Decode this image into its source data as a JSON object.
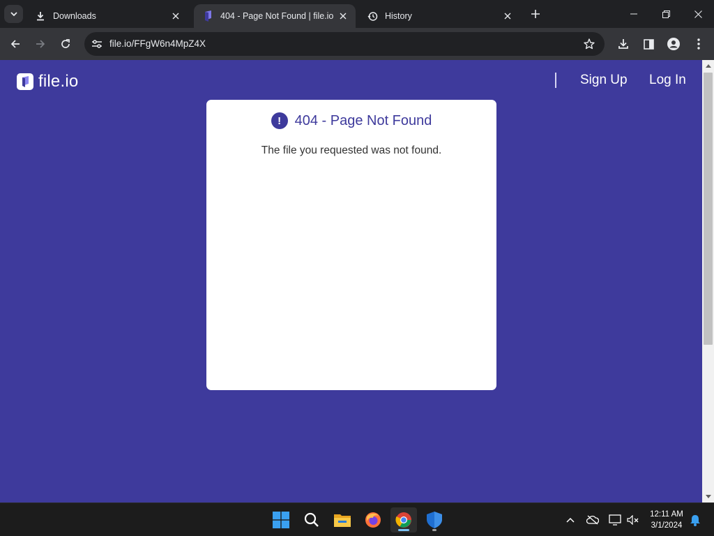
{
  "browser": {
    "tabs": [
      {
        "title": "Downloads",
        "icon": "download-icon",
        "active": false
      },
      {
        "title": "404 - Page Not Found | file.io",
        "icon": "fileio-favicon",
        "active": true
      },
      {
        "title": "History",
        "icon": "history-icon",
        "active": false
      }
    ],
    "address_bar": {
      "url": "file.io/FFgW6n4MpZ4X"
    }
  },
  "page": {
    "logo_text": "file.io",
    "nav": {
      "sign_up": "Sign Up",
      "log_in": "Log In"
    },
    "error_card": {
      "title": "404 - Page Not Found",
      "message": "The file you requested was not found.",
      "icon_glyph": "!"
    },
    "colors": {
      "brand": "#3e3a9c",
      "card_bg": "#ffffff"
    }
  },
  "taskbar": {
    "apps": [
      "start-button",
      "search",
      "file-explorer",
      "firefox",
      "chrome",
      "windows-security"
    ],
    "clock": {
      "time": "12:11 AM",
      "date": "3/1/2024"
    }
  }
}
